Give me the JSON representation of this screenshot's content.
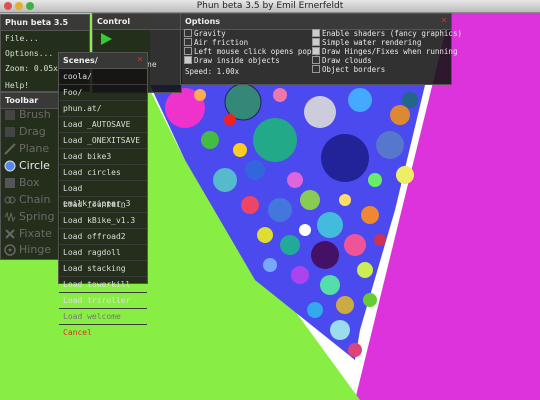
{
  "window": {
    "title": "Phun beta 3.5 by Emil Ernerfeldt"
  },
  "main_panel": {
    "title": "Phun beta 3.5",
    "items": [
      "File...",
      "Options...",
      "Zoom: 0.05x",
      "Help!"
    ]
  },
  "control_panel": {
    "title": "Control",
    "play_label": "",
    "overlap_text": "ne"
  },
  "options_panel": {
    "title": "Options",
    "left": [
      "Gravity",
      "Air friction",
      "Left mouse click opens popup",
      "Draw inside objects"
    ],
    "left_checked": [
      false,
      false,
      false,
      true
    ],
    "right": [
      "Enable shaders (fancy graphics)",
      "Simple water rendering",
      "Draw Hinges/Fixes when running",
      "Draw clouds",
      "Object borders"
    ],
    "right_checked": [
      true,
      true,
      true,
      false,
      false
    ],
    "speed": "Speed: 1.00x"
  },
  "toolbar": {
    "title": "Toolbar",
    "tools": [
      "Brush",
      "Drag",
      "Plane",
      "Circle",
      "Box",
      "Chain",
      "Spring",
      "Fixate",
      "Hinge"
    ],
    "active": "Circle"
  },
  "scenes_panel": {
    "title": "Scenes/",
    "items": [
      "coola/",
      "Foo/",
      "phun.at/",
      "Load _AUTOSAVE",
      "Load _ONEXITSAVE",
      "Load bike3",
      "Load circles",
      "Load emilk_zipper_3",
      "Load fountain",
      "Load kBike_v1.3",
      "Load offroad2",
      "Load ragdoll",
      "Load stacking",
      "Load towerkill",
      "Load triroller",
      "Load welcome",
      "Cancel"
    ]
  },
  "colors": {
    "green_ground": "#88ee44",
    "magenta_wall": "#dd33dd",
    "blue_funnel": "#4a4aee",
    "cancel_red": "#e0312a"
  }
}
